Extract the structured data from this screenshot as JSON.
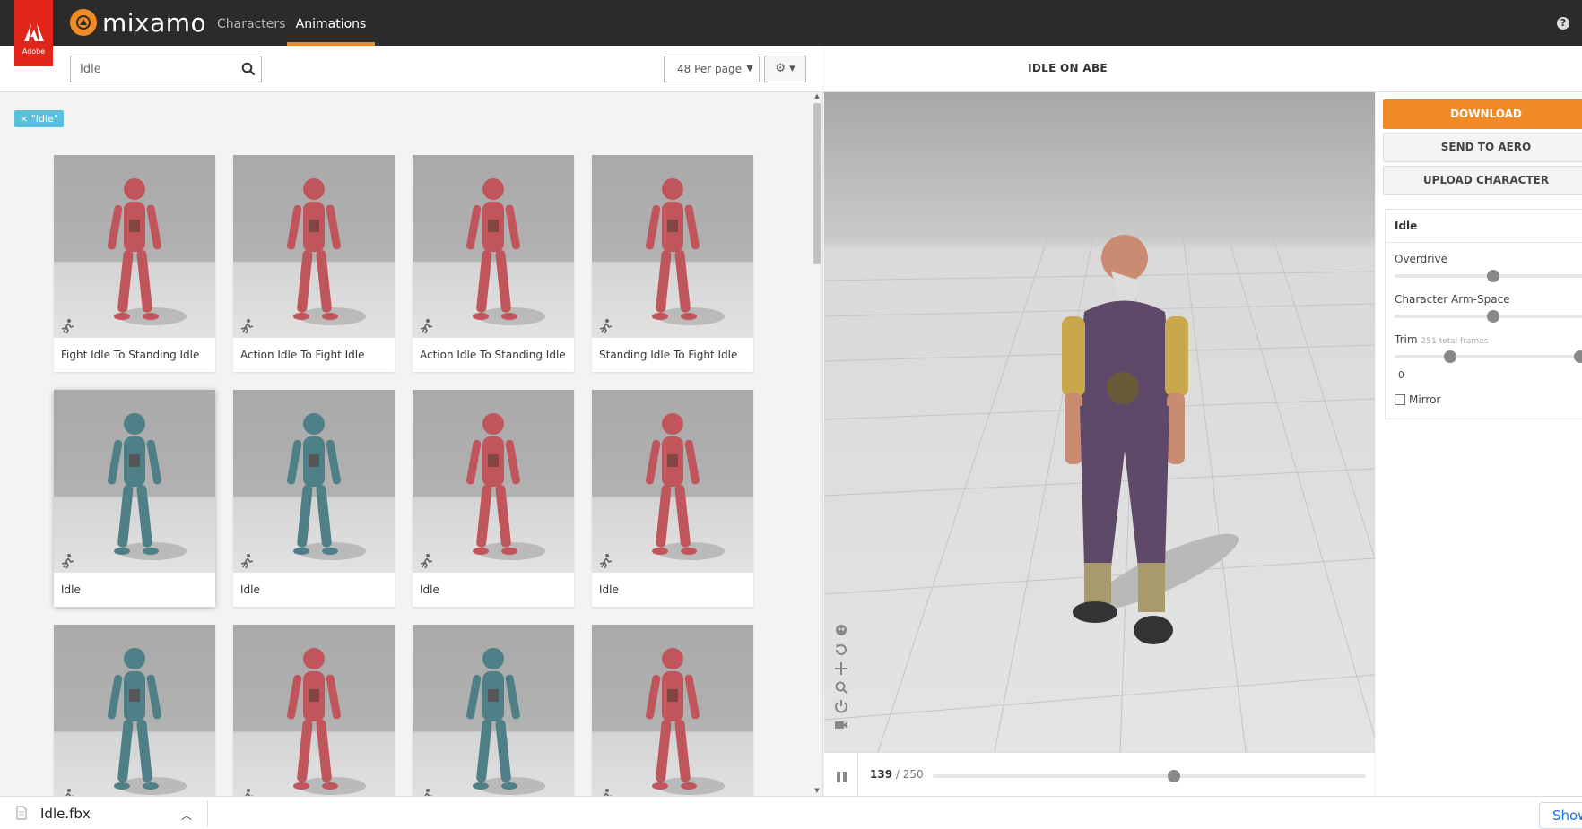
{
  "topbar": {
    "adobe_label": "Adobe",
    "logo_text": "mixamo",
    "nav": [
      {
        "label": "Characters",
        "active": false
      },
      {
        "label": "Animations",
        "active": true
      }
    ],
    "help_label": "?"
  },
  "toolbar": {
    "search_value": "Idle",
    "per_page": "48 Per page",
    "settings_icon": "gear-icon"
  },
  "filter_tag": "× \"Idle\"",
  "cards": [
    {
      "label": "Fight Idle To Standing Idle",
      "color": "#c0565c"
    },
    {
      "label": "Action Idle To Fight Idle",
      "color": "#c0565c"
    },
    {
      "label": "Action Idle To Standing Idle",
      "color": "#c0565c"
    },
    {
      "label": "Standing Idle To Fight Idle",
      "color": "#c0565c"
    },
    {
      "label": "Idle",
      "color": "#4f7f87",
      "selected": true
    },
    {
      "label": "Idle",
      "color": "#4f7f87"
    },
    {
      "label": "Idle",
      "color": "#c0565c"
    },
    {
      "label": "Idle",
      "color": "#c0565c"
    },
    {
      "label": "",
      "color": "#4f7f87"
    },
    {
      "label": "",
      "color": "#c0565c"
    },
    {
      "label": "",
      "color": "#4f7f87"
    },
    {
      "label": "",
      "color": "#c0565c"
    }
  ],
  "viewer": {
    "title": "IDLE ON ABE",
    "frame_current": "139",
    "frame_total": "/ 250",
    "timeline_progress": 0.556
  },
  "sidebar": {
    "download_label": "DOWNLOAD",
    "send_label": "SEND TO AERO",
    "upload_label": "UPLOAD CHARACTER",
    "settings_title": "Idle",
    "overdrive_label": "Overdrive",
    "overdrive_value": 0.5,
    "armspace_label": "Character Arm-Space",
    "armspace_value": 0.5,
    "trim_label": "Trim",
    "trim_hint": "251 total frames",
    "trim_start_value": "0",
    "trim_range": [
      0.28,
      1.0
    ],
    "mirror_label": "Mirror",
    "mirror_checked": false
  },
  "downloads": {
    "file_name": "Idle.fbx",
    "show_all_label": "Show"
  }
}
